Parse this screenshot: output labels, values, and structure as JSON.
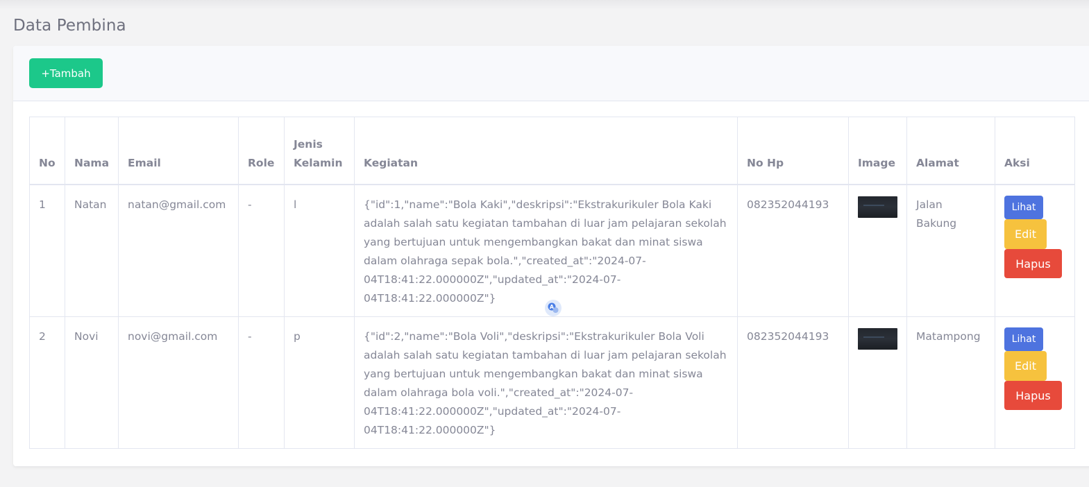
{
  "page": {
    "title": "Data Pembina"
  },
  "toolbar": {
    "add_label": "+Tambah"
  },
  "table": {
    "headers": [
      "No",
      "Nama",
      "Email",
      "Role",
      "Jenis Kelamin",
      "Kegiatan",
      "No Hp",
      "Image",
      "Alamat",
      "Aksi"
    ],
    "rows": [
      {
        "no": "1",
        "nama": "Natan",
        "email": "natan@gmail.com",
        "role": "-",
        "jenis_kelamin": "l",
        "kegiatan": "{\"id\":1,\"name\":\"Bola Kaki\",\"deskripsi\":\"Ekstrakurikuler Bola Kaki adalah salah satu kegiatan tambahan di luar jam pelajaran sekolah yang bertujuan untuk mengembangkan bakat dan minat siswa dalam olahraga sepak bola.\",\"created_at\":\"2024-07-04T18:41:22.000000Z\",\"updated_at\":\"2024-07-04T18:41:22.000000Z\"}",
        "no_hp": "082352044193",
        "alamat": "Jalan Bakung"
      },
      {
        "no": "2",
        "nama": "Novi",
        "email": "novi@gmail.com",
        "role": "-",
        "jenis_kelamin": "p",
        "kegiatan": "{\"id\":2,\"name\":\"Bola Voli\",\"deskripsi\":\"Ekstrakurikuler Bola Voli adalah salah satu kegiatan tambahan di luar jam pelajaran sekolah yang bertujuan untuk mengembangkan bakat dan minat siswa dalam olahraga bola voli.\",\"created_at\":\"2024-07-04T18:41:22.000000Z\",\"updated_at\":\"2024-07-04T18:41:22.000000Z\"}",
        "no_hp": "082352044193",
        "alamat": "Matampong"
      }
    ],
    "actions": {
      "view_label": "Lihat",
      "edit_label": "Edit",
      "delete_label": "Hapus"
    }
  },
  "colors": {
    "primary": "#4e73df",
    "success": "#1cc88a",
    "warning": "#f6c23e",
    "danger": "#e74a3b",
    "text": "#858796"
  },
  "icons": {
    "floating": "translate-icon"
  }
}
